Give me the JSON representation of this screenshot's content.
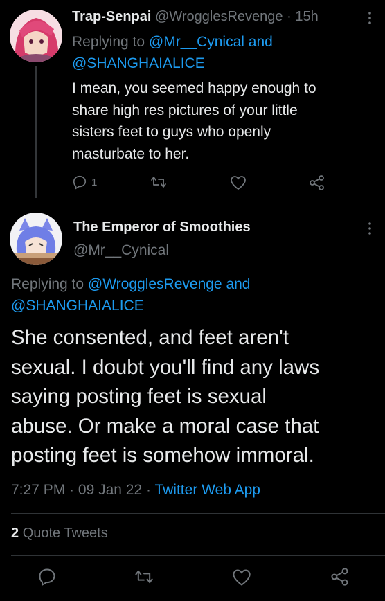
{
  "reply": {
    "display_name": "Trap-Senpai",
    "handle": "@WrogglesRevenge",
    "separator": "·",
    "time_ago": "15h",
    "replying_prefix": "Replying to",
    "replying_user1": "@Mr__Cynical",
    "replying_and": "and",
    "replying_user2": "@SHANGHAIALICE",
    "lines": [
      "I mean, you seemed happy enough to",
      "share high res pictures of your little",
      "sisters feet to guys who openly",
      "masturbate to her."
    ],
    "reply_count": "1",
    "icons": {
      "more": "more-icon",
      "reply": "reply-icon",
      "retweet": "retweet-icon",
      "like": "like-icon",
      "share": "share-icon"
    }
  },
  "main": {
    "display_name": "The Emperor of Smoothies",
    "handle": "@Mr__Cynical",
    "replying_prefix": "Replying to",
    "replying_user1": "@WrogglesRevenge",
    "replying_and": "and",
    "replying_user2": "@SHANGHAIALICE",
    "lines": [
      "She consented, and feet aren't",
      "sexual. I doubt you'll find any laws",
      "saying posting feet is sexual",
      "abuse. Or make a moral case that",
      "posting feet is somehow immoral."
    ],
    "time": "7:27 PM",
    "dot1": "·",
    "date": "09 Jan 22",
    "dot2": "·",
    "client": "Twitter Web App",
    "quote_count": "2",
    "quote_label": "Quote Tweets"
  },
  "colors": {
    "background": "#000000",
    "text": "#e7e9ea",
    "secondary": "#71767b",
    "link": "#1d9bf0",
    "divider": "#2f3336"
  }
}
